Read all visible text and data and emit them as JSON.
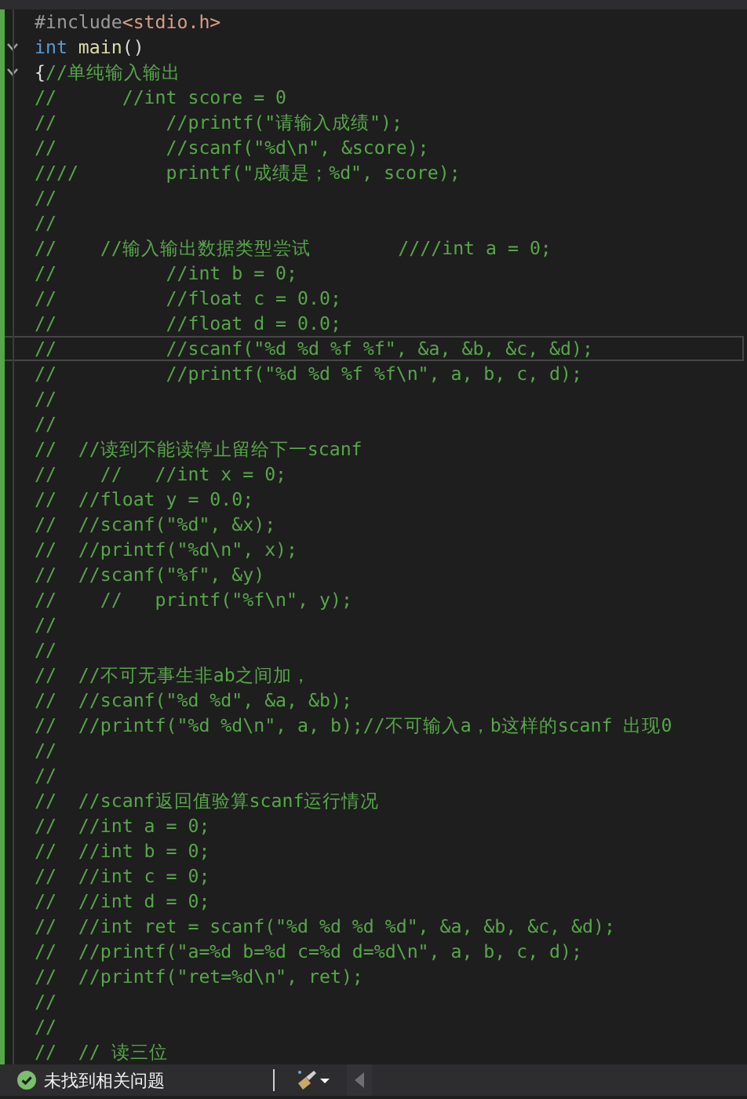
{
  "editor": {
    "lines": [
      {
        "segments": [
          {
            "kind": "preprocessor",
            "text": "#include"
          },
          {
            "kind": "string",
            "text": "<stdio.h>"
          }
        ]
      },
      {
        "expanded": true,
        "segments": [
          {
            "kind": "keyword",
            "text": "int "
          },
          {
            "kind": "function",
            "text": "main"
          },
          {
            "kind": "plain",
            "text": "()"
          }
        ]
      },
      {
        "expanded": true,
        "segments": [
          {
            "kind": "plain",
            "text": "{"
          },
          {
            "kind": "comment",
            "text": "//单纯输入输出"
          }
        ]
      },
      {
        "segments": [
          {
            "kind": "comment",
            "text": "//      //int score = 0"
          }
        ]
      },
      {
        "segments": [
          {
            "kind": "comment",
            "text": "//          //printf(\"请输入成绩\");"
          }
        ]
      },
      {
        "segments": [
          {
            "kind": "comment",
            "text": "//          //scanf(\"%d\\n\", &score);"
          }
        ]
      },
      {
        "segments": [
          {
            "kind": "comment",
            "text": "////        printf(\"成绩是；%d\", score);"
          }
        ]
      },
      {
        "segments": [
          {
            "kind": "comment",
            "text": "//"
          }
        ]
      },
      {
        "segments": [
          {
            "kind": "comment",
            "text": "//"
          }
        ]
      },
      {
        "segments": [
          {
            "kind": "comment",
            "text": "//    //输入输出数据类型尝试        ////int a = 0;"
          }
        ]
      },
      {
        "segments": [
          {
            "kind": "comment",
            "text": "//          //int b = 0;"
          }
        ]
      },
      {
        "segments": [
          {
            "kind": "comment",
            "text": "//          //float c = 0.0;"
          }
        ]
      },
      {
        "segments": [
          {
            "kind": "comment",
            "text": "//          //float d = 0.0;"
          }
        ]
      },
      {
        "current": true,
        "segments": [
          {
            "kind": "comment",
            "text": "//          //scanf(\"%d %d %f %f\", &a, &b, &c, &d);"
          }
        ]
      },
      {
        "segments": [
          {
            "kind": "comment",
            "text": "//          //printf(\"%d %d %f %f\\n\", a, b, c, d);"
          }
        ]
      },
      {
        "segments": [
          {
            "kind": "comment",
            "text": "//"
          }
        ]
      },
      {
        "segments": [
          {
            "kind": "comment",
            "text": "//"
          }
        ]
      },
      {
        "segments": [
          {
            "kind": "comment",
            "text": "//  //读到不能读停止留给下一scanf"
          }
        ]
      },
      {
        "segments": [
          {
            "kind": "comment",
            "text": "//    //   //int x = 0;"
          }
        ]
      },
      {
        "segments": [
          {
            "kind": "comment",
            "text": "//  //float y = 0.0;"
          }
        ]
      },
      {
        "segments": [
          {
            "kind": "comment",
            "text": "//  //scanf(\"%d\", &x);"
          }
        ]
      },
      {
        "segments": [
          {
            "kind": "comment",
            "text": "//  //printf(\"%d\\n\", x);"
          }
        ]
      },
      {
        "segments": [
          {
            "kind": "comment",
            "text": "//  //scanf(\"%f\", &y)"
          }
        ]
      },
      {
        "segments": [
          {
            "kind": "comment",
            "text": "//    //   printf(\"%f\\n\", y);"
          }
        ]
      },
      {
        "segments": [
          {
            "kind": "comment",
            "text": "//"
          }
        ]
      },
      {
        "segments": [
          {
            "kind": "comment",
            "text": "//"
          }
        ]
      },
      {
        "segments": [
          {
            "kind": "comment",
            "text": "//  //不可无事生非ab之间加，"
          }
        ]
      },
      {
        "segments": [
          {
            "kind": "comment",
            "text": "//  //scanf(\"%d %d\", &a, &b);"
          }
        ]
      },
      {
        "segments": [
          {
            "kind": "comment",
            "text": "//  //printf(\"%d %d\\n\", a, b);//不可输入a，b这样的scanf 出现0"
          }
        ]
      },
      {
        "segments": [
          {
            "kind": "comment",
            "text": "//"
          }
        ]
      },
      {
        "segments": [
          {
            "kind": "comment",
            "text": "//"
          }
        ]
      },
      {
        "segments": [
          {
            "kind": "comment",
            "text": "//  //scanf返回值验算scanf运行情况"
          }
        ]
      },
      {
        "segments": [
          {
            "kind": "comment",
            "text": "//  //int a = 0;"
          }
        ]
      },
      {
        "segments": [
          {
            "kind": "comment",
            "text": "//  //int b = 0;"
          }
        ]
      },
      {
        "segments": [
          {
            "kind": "comment",
            "text": "//  //int c = 0;"
          }
        ]
      },
      {
        "segments": [
          {
            "kind": "comment",
            "text": "//  //int d = 0;"
          }
        ]
      },
      {
        "segments": [
          {
            "kind": "comment",
            "text": "//  //int ret = scanf(\"%d %d %d %d\", &a, &b, &c, &d);"
          }
        ]
      },
      {
        "segments": [
          {
            "kind": "comment",
            "text": "//  //printf(\"a=%d b=%d c=%d d=%d\\n\", a, b, c, d);"
          }
        ]
      },
      {
        "segments": [
          {
            "kind": "comment",
            "text": "//  //printf(\"ret=%d\\n\", ret);"
          }
        ]
      },
      {
        "segments": [
          {
            "kind": "comment",
            "text": "//"
          }
        ]
      },
      {
        "segments": [
          {
            "kind": "comment",
            "text": "//"
          }
        ]
      },
      {
        "segments": [
          {
            "kind": "comment",
            "text": "//  // 读三位"
          }
        ]
      }
    ]
  },
  "status_bar": {
    "issues": "未找到相关问题"
  }
}
